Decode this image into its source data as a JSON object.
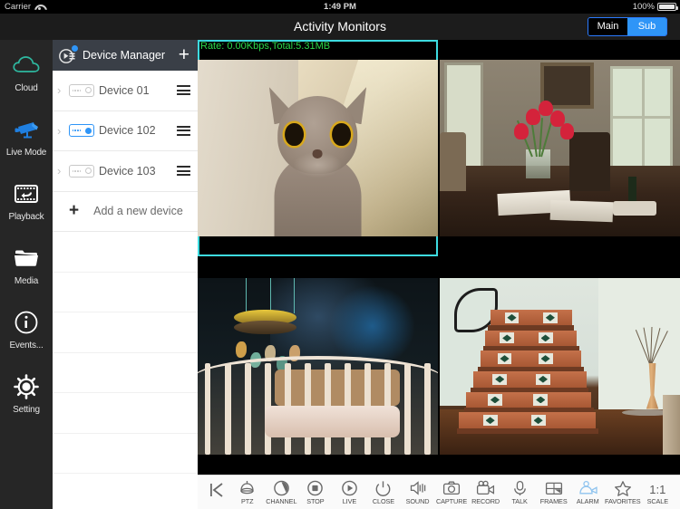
{
  "status_bar": {
    "carrier": "Carrier",
    "wifi_icon": "wifi-icon",
    "time": "1:49 PM",
    "battery_percent": "100%",
    "battery_icon": "battery-full-icon"
  },
  "navbar": {
    "title": "Activity Monitors",
    "stream_toggle": {
      "options": [
        "Main",
        "Sub"
      ],
      "selected": "Sub",
      "active_color": "#2f95f7"
    }
  },
  "sidebar": {
    "background": "#262626",
    "items": [
      {
        "label": "Cloud",
        "icon": "cloud-icon",
        "color": "#2eb8a0"
      },
      {
        "label": "Live Mode",
        "icon": "cctv-camera-icon",
        "color": "#2f95f7"
      },
      {
        "label": "Playback",
        "icon": "playback-film-icon",
        "color": "#ffffff"
      },
      {
        "label": "Media",
        "icon": "folder-icon",
        "color": "#ffffff"
      },
      {
        "label": "Events...",
        "icon": "info-circle-icon",
        "color": "#ffffff"
      },
      {
        "label": "Setting",
        "icon": "gear-icon",
        "color": "#ffffff"
      }
    ]
  },
  "device_panel": {
    "header": {
      "title": "Device Manager",
      "icon": "device-manager-icon",
      "badge": true,
      "add_label": "+"
    },
    "devices": [
      {
        "name": "Device 01",
        "connected": false,
        "expand_icon": "chevron-right-icon",
        "status_icon": "dvr-device-icon",
        "menu_icon": "hamburger-icon"
      },
      {
        "name": "Device 102",
        "connected": true,
        "expand_icon": "chevron-right-icon",
        "status_icon": "dvr-device-icon",
        "menu_icon": "hamburger-icon"
      },
      {
        "name": "Device 103",
        "connected": false,
        "expand_icon": "chevron-right-icon",
        "status_icon": "dvr-device-icon",
        "menu_icon": "hamburger-icon"
      }
    ],
    "add_device": {
      "label": "Add a new device",
      "icon": "plus-icon"
    }
  },
  "video_grid": {
    "layout": "2x2",
    "selected_index": 0,
    "selection_color": "#3ddbe0",
    "cells": [
      {
        "overlay": "Rate: 0.00Kbps,Total:5.31MB",
        "overlay_color": "#2bd84a",
        "scene": "cat-closeup"
      },
      {
        "overlay": "",
        "scene": "dining-room-tulips"
      },
      {
        "overlay": "",
        "scene": "baby-crib-mobile"
      },
      {
        "overlay": "",
        "scene": "tiled-staircase"
      }
    ]
  },
  "toolbar": {
    "back_icon": "skip-back-icon",
    "items": [
      {
        "label": "PTZ",
        "icon": "ptz-dome-icon"
      },
      {
        "label": "CHANNEL",
        "icon": "channel-circle-icon"
      },
      {
        "label": "STOP",
        "icon": "stop-icon"
      },
      {
        "label": "LIVE",
        "icon": "play-icon"
      },
      {
        "label": "CLOSE",
        "icon": "power-icon"
      },
      {
        "label": "SOUND",
        "icon": "speaker-icon"
      },
      {
        "label": "CAPTURE",
        "icon": "camera-icon"
      },
      {
        "label": "RECORD",
        "icon": "video-camera-icon"
      },
      {
        "label": "TALK",
        "icon": "microphone-icon"
      },
      {
        "label": "FRAMES",
        "icon": "frames-grid-icon"
      },
      {
        "label": "ALARM",
        "icon": "alarm-bell-icon",
        "highlighted": true
      },
      {
        "label": "FAVORITES",
        "icon": "star-icon"
      },
      {
        "label": "SCALE",
        "icon": "scale-1-1-icon",
        "glyph": "1:1"
      }
    ]
  }
}
